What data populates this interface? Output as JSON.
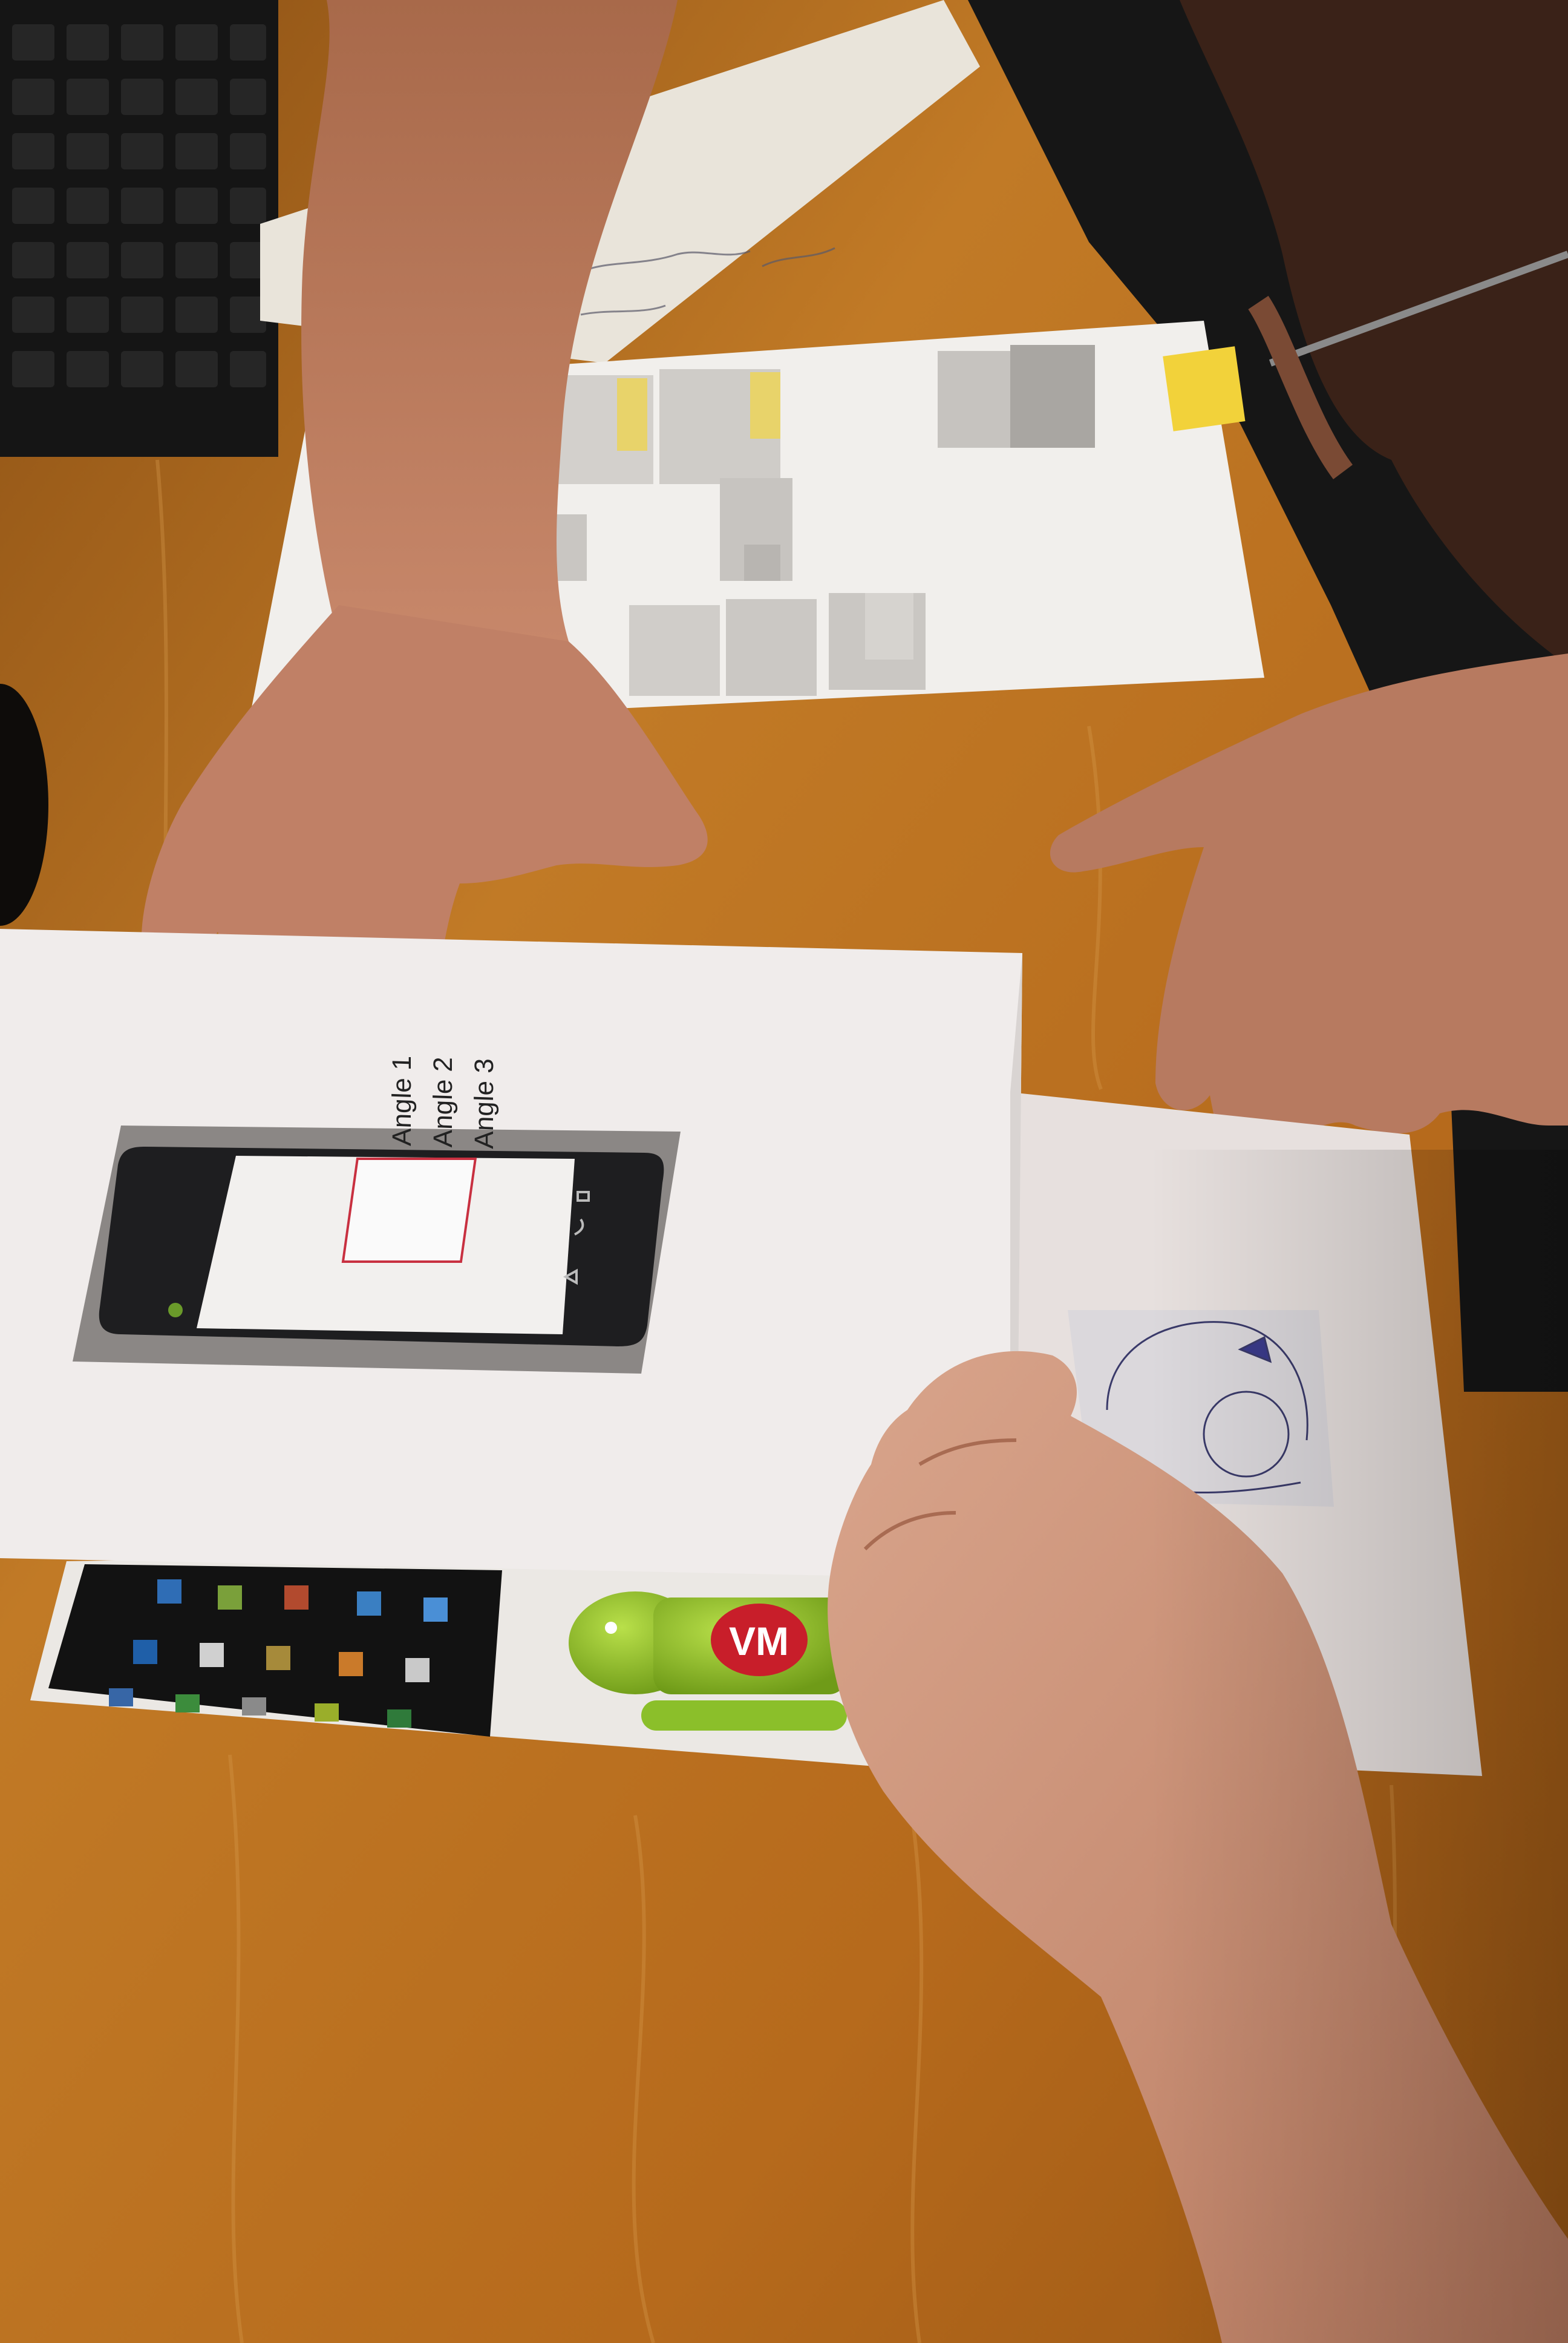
{
  "phone_prototype": {
    "list_items": [
      "Angle 1",
      "Angle 2",
      "Angle 3"
    ]
  },
  "logo_sticker": {
    "badge_text": "VM"
  },
  "colors": {
    "table_wood": "#b9701e",
    "paper": "#eeeae6",
    "phone_body": "#1e1e20",
    "android_green": "#8bbf2a",
    "vm_red": "#c81e2a",
    "sticky_note": "#f2d23a"
  }
}
